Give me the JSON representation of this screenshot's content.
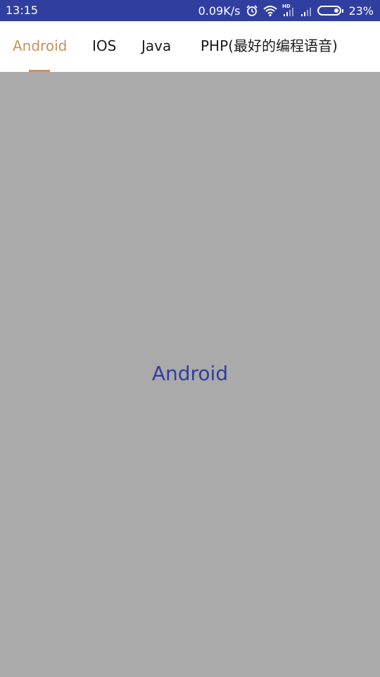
{
  "status_bar": {
    "time": "13:15",
    "network_speed": "0.09K/s",
    "battery_percent": "23%",
    "battery_level": 0.23,
    "icons": [
      "alarm-icon",
      "wifi-icon",
      "hd-signal-icon",
      "signal-icon",
      "battery-icon"
    ],
    "background_color": "#303f9f"
  },
  "tabs": {
    "items": [
      {
        "label": "Android",
        "selected": true
      },
      {
        "label": "IOS",
        "selected": false
      },
      {
        "label": "Java",
        "selected": false
      },
      {
        "label": "PHP(最好的编程语音)",
        "selected": false
      }
    ],
    "selected_color": "#c6945e",
    "text_color": "#1b1b1b"
  },
  "content": {
    "title": "Android",
    "title_color": "#303f9f",
    "background_color": "#aaaaaa"
  }
}
